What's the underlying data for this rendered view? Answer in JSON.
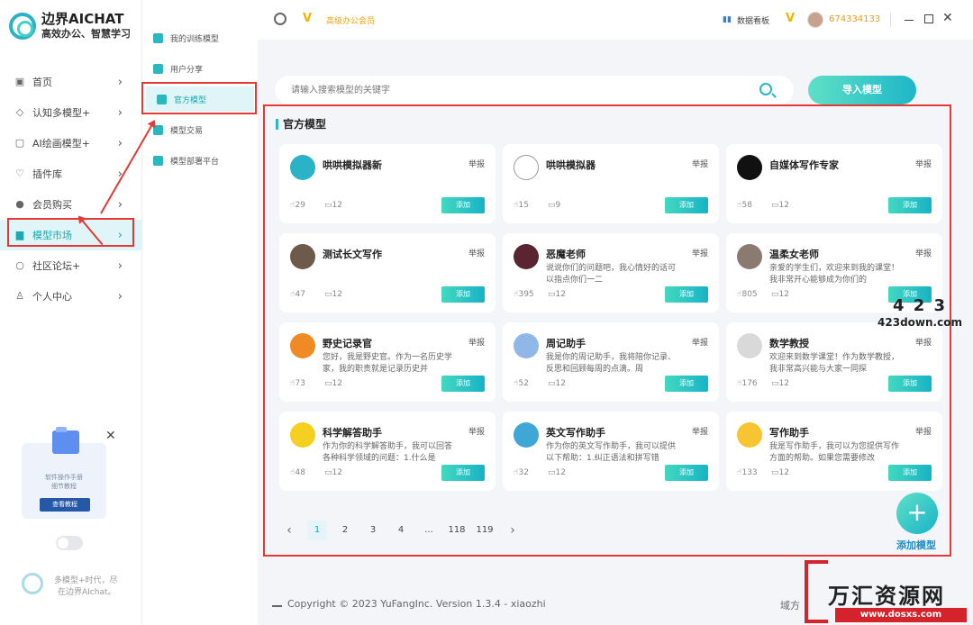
{
  "brand": {
    "name": "边界AICHAT",
    "slogan": "高效办公、智慧学习"
  },
  "sidebar": {
    "items": [
      {
        "label": "首页",
        "icon": "home-icon"
      },
      {
        "label": "认知多模型+",
        "icon": "cube-icon"
      },
      {
        "label": "AI绘画模型+",
        "icon": "image-icon"
      },
      {
        "label": "插件库",
        "icon": "plugin-icon"
      },
      {
        "label": "会员购买",
        "icon": "user-icon"
      },
      {
        "label": "模型市场",
        "icon": "shop-icon",
        "active": true
      },
      {
        "label": "社区论坛+",
        "icon": "chat-icon"
      },
      {
        "label": "个人中心",
        "icon": "person-icon"
      }
    ],
    "promo": {
      "line1": "软件操作手册",
      "line2": "细节教程",
      "button": "查看教程"
    },
    "footer": {
      "line1": "多模型+时代，尽",
      "line2": "在边界AIchat。"
    }
  },
  "subnav": {
    "items": [
      {
        "label": "我的训练模型"
      },
      {
        "label": "用户分享"
      },
      {
        "label": "官方模型",
        "active": true
      },
      {
        "label": "模型交易"
      },
      {
        "label": "模型部署平台"
      }
    ]
  },
  "topbar": {
    "vip_label": "高级办公会员",
    "dashboard": "数据看板",
    "user_id": "674334133"
  },
  "search": {
    "placeholder": "请输入搜索模型的关键字"
  },
  "import_button": "导入模型",
  "section_title": "官方模型",
  "cards": [
    {
      "name": "哄哄模拟器新",
      "desc": "",
      "likes": "29",
      "comments": "12",
      "report": "举报",
      "add": "添加",
      "color": "#2ab3c6"
    },
    {
      "name": "哄哄模拟器",
      "desc": "",
      "likes": "15",
      "comments": "9",
      "report": "举报",
      "add": "添加",
      "color": "#ffffff"
    },
    {
      "name": "自媒体写作专家",
      "desc": "",
      "likes": "58",
      "comments": "12",
      "report": "举报",
      "add": "添加",
      "color": "#111111"
    },
    {
      "name": "测试长文写作",
      "desc": "",
      "likes": "47",
      "comments": "12",
      "report": "举报",
      "add": "添加",
      "color": "#6d5a4a"
    },
    {
      "name": "恶魔老师",
      "desc": "说说你们的问题吧，我心情好的话可以指点你们一二",
      "likes": "395",
      "comments": "12",
      "report": "举报",
      "add": "添加",
      "color": "#5a2430"
    },
    {
      "name": "温柔女老师",
      "desc": "亲爱的学生们，欢迎来到我的课堂！我非常开心能够成为你们的",
      "likes": "805",
      "comments": "12",
      "report": "举报",
      "add": "添加",
      "color": "#8a7a70"
    },
    {
      "name": "野史记录官",
      "desc": "您好，我是野史官。作为一名历史学家，我的职责就是记录历史并",
      "likes": "73",
      "comments": "12",
      "report": "举报",
      "add": "添加",
      "color": "#f08a24"
    },
    {
      "name": "周记助手",
      "desc": "我是你的周记助手，我将陪你记录、反思和回顾每周的点滴。周",
      "likes": "52",
      "comments": "12",
      "report": "举报",
      "add": "添加",
      "color": "#8fb8e8"
    },
    {
      "name": "数学教授",
      "desc": "欢迎来到数学课堂！作为数学教授，我非常高兴能与大家一同探",
      "likes": "176",
      "comments": "12",
      "report": "举报",
      "add": "添加",
      "color": "#d9d9d9"
    },
    {
      "name": "科学解答助手",
      "desc": "作为你的科学解答助手，我可以回答各种科学领域的问题：1.什么是",
      "likes": "48",
      "comments": "12",
      "report": "举报",
      "add": "添加",
      "color": "#f5d020"
    },
    {
      "name": "英文写作助手",
      "desc": "作为你的英文写作助手，我可以提供以下帮助：1.纠正语法和拼写错",
      "likes": "32",
      "comments": "12",
      "report": "举报",
      "add": "添加",
      "color": "#3fa7d6"
    },
    {
      "name": "写作助手",
      "desc": "我是写作助手，我可以为您提供写作方面的帮助。如果您需要修改",
      "likes": "133",
      "comments": "12",
      "report": "举报",
      "add": "添加",
      "color": "#f7c531"
    }
  ],
  "pagination": {
    "pages": [
      "1",
      "2",
      "3",
      "4",
      "...",
      "118",
      "119"
    ],
    "current": "1"
  },
  "add_model": "添加模型",
  "copyright": "Copyright © 2023 YuFangInc. Version 1.3.4 - xiaozhi",
  "footer_right": "域方",
  "watermarks": {
    "site1_big": "4 2 3",
    "site1_small": "423down.com",
    "site2_name": "万汇资源网",
    "site2_url": "www.dosxs.com"
  }
}
